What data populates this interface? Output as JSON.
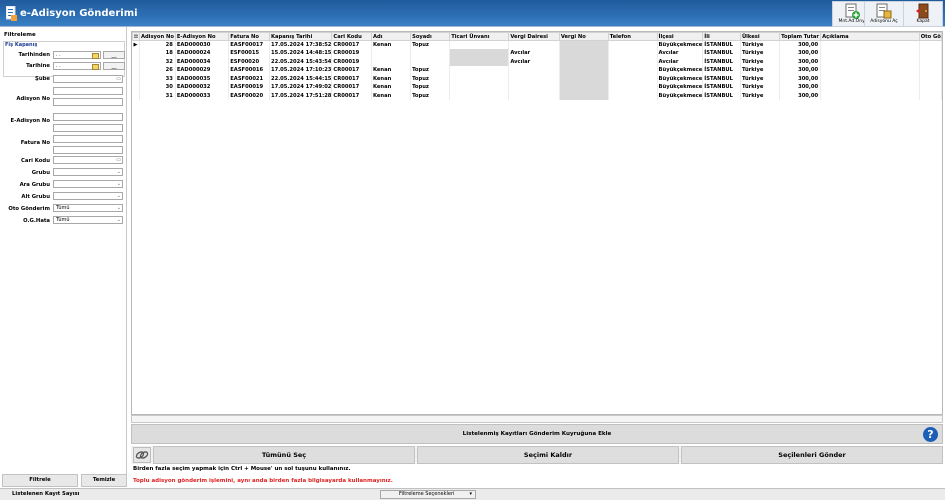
{
  "window": {
    "title": "e-Adisyon Gönderimi"
  },
  "toolbar": {
    "buttons": [
      {
        "label": "Mnt.Ad.Ony.",
        "icon": "document-add-icon"
      },
      {
        "label": "Adisyonu Aç",
        "icon": "open-document-icon"
      },
      {
        "label": "Kapat",
        "icon": "exit-door-icon"
      }
    ]
  },
  "filter": {
    "heading": "Filtreleme",
    "group_label": "Fiş Kapanış",
    "date_from_label": "Tarihinden",
    "date_to_label": "Tarihine",
    "date_from_value": " . .",
    "date_to_value": " . .",
    "date_btn": "__",
    "sube_label": "Şube",
    "adisyon_no_label": "Adisyon No",
    "e_adisyon_no_label": "E-Adisyon No",
    "fatura_no_label": "Fatura No",
    "cari_kodu_label": "Cari Kodu",
    "grubu_label": "Grubu",
    "ara_grubu_label": "Ara Grubu",
    "alt_grubu_label": "Alt Grubu",
    "oto_gonderim_label": "Oto Gönderim",
    "oto_gonderim_value": "Tümü",
    "og_hata_label": "O.G.Hata",
    "og_hata_value": "Tümü",
    "filter_button": "Filtrele",
    "clear_button": "Temizle"
  },
  "grid": {
    "columns": [
      "Adisyon No",
      "E-Adisyon No",
      "Fatura No",
      "Kapanış Tarihi",
      "Cari Kodu",
      "Adı",
      "Soyadı",
      "Ticari Ünvanı",
      "Vergi Dairesi",
      "Vergi No",
      "Telefon",
      "İlçesi",
      "İli",
      "Ülkesi",
      "Toplam Tutar",
      "Açıklama",
      "Oto Gö"
    ],
    "rows": [
      [
        "28",
        "EAD000030",
        "EASF00017",
        "17.05.2024 17:38:52",
        "CR00017",
        "Kenan",
        "Topuz",
        "",
        "",
        "",
        "",
        "Büyükçekmece",
        "İSTANBUL",
        "Türkiye",
        "300,00",
        "",
        ""
      ],
      [
        "18",
        "EAD000024",
        "ESF00015",
        "15.05.2024 14:48:15",
        "CR00019",
        "",
        "",
        "",
        "Avcılar",
        "",
        "",
        "Avcılar",
        "İSTANBUL",
        "Türkiye",
        "300,00",
        "",
        ""
      ],
      [
        "32",
        "EAD000034",
        "ESF00020",
        "22.05.2024 15:43:54",
        "CR00019",
        "",
        "",
        "",
        "Avcılar",
        "",
        "",
        "Avcılar",
        "İSTANBUL",
        "Türkiye",
        "300,00",
        "",
        ""
      ],
      [
        "26",
        "EAD000029",
        "EASF00016",
        "17.05.2024 17:10:23",
        "CR00017",
        "Kenan",
        "Topuz",
        "",
        "",
        "",
        "",
        "Büyükçekmece",
        "İSTANBUL",
        "Türkiye",
        "300,00",
        "",
        ""
      ],
      [
        "33",
        "EAD000035",
        "EASF00021",
        "22.05.2024 15:44:15",
        "CR00017",
        "Kenan",
        "Topuz",
        "",
        "",
        "",
        "",
        "Büyükçekmece",
        "İSTANBUL",
        "Türkiye",
        "300,00",
        "",
        ""
      ],
      [
        "30",
        "EAD000032",
        "EASF00019",
        "17.05.2024 17:49:02",
        "CR00017",
        "Kenan",
        "Topuz",
        "",
        "",
        "",
        "",
        "Büyükçekmece",
        "İSTANBUL",
        "Türkiye",
        "300,00",
        "",
        ""
      ],
      [
        "31",
        "EAD000033",
        "EASF00020",
        "17.05.2024 17:51:28",
        "CR00017",
        "Kenan",
        "Topuz",
        "",
        "",
        "",
        "",
        "Büyükçekmece",
        "İSTANBUL",
        "Türkiye",
        "300,00",
        "",
        ""
      ]
    ]
  },
  "queue_bar": {
    "label": "Listelenmiş Kayıtları Gönderim Kuyruğuna Ekle"
  },
  "actions": {
    "select_all": "Tümünü Seç",
    "deselect": "Seçimi Kaldır",
    "send_selected": "Seçilenleri Gönder"
  },
  "info": {
    "hint": "Birden fazla seçim yapmak için Ctrl + Mouse' un sol tuşunu kullanınız.",
    "warning": "Toplu adisyon gönderim işlemini, aynı anda birden fazla bilgisayarda kullanmayınız."
  },
  "status": {
    "record_count_label": "Listelenen Kayıt Sayısı",
    "filter_options": "Filtreleme Seçenekleri"
  },
  "colors": {
    "title_bar": "#2d6fb4",
    "warning": "#e02020",
    "help": "#1d5fb6"
  }
}
